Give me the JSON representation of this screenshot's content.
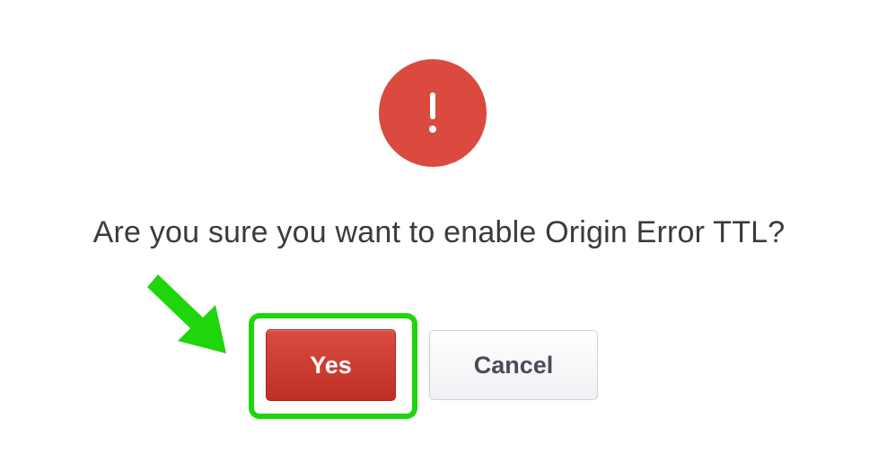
{
  "dialog": {
    "icon": "exclamation-alert-icon",
    "icon_color": "#db4a3e",
    "question": "Are you sure you want to enable Origin Error TTL?",
    "buttons": {
      "yes_label": "Yes",
      "cancel_label": "Cancel"
    },
    "colors": {
      "primary": "#c9362b",
      "highlight": "#1fd60d"
    }
  }
}
